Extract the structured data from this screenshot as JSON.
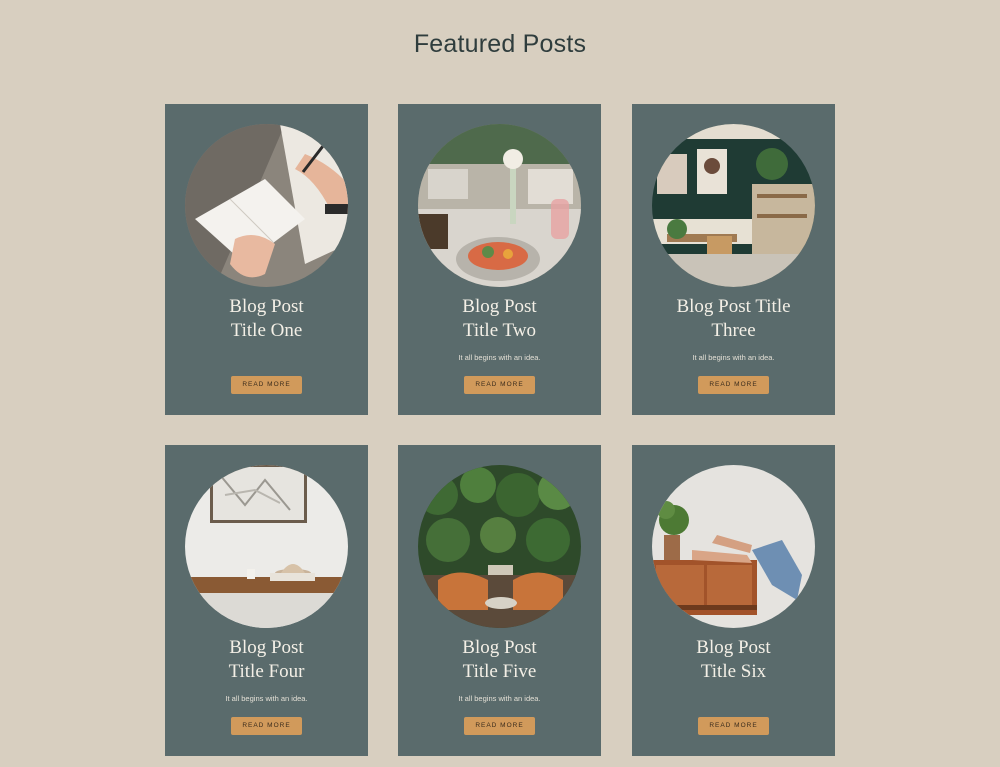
{
  "page": {
    "title": "Featured Posts"
  },
  "posts": [
    {
      "title_line1": "Blog Post",
      "title_line2": "Title One",
      "excerpt": "",
      "button": "READ MORE",
      "image": "writing-notebook-photo"
    },
    {
      "title_line1": "Blog Post",
      "title_line2": "Title Two",
      "excerpt": "It all begins with an idea.",
      "button": "READ MORE",
      "image": "restaurant-table-photo"
    },
    {
      "title_line1": "Blog Post Title",
      "title_line2": "Three",
      "excerpt": "It all begins with an idea.",
      "button": "READ MORE",
      "image": "cafe-interior-photo"
    },
    {
      "title_line1": "Blog Post",
      "title_line2": "Title Four",
      "excerpt": "It all begins with an idea.",
      "button": "READ MORE",
      "image": "console-shelf-photo"
    },
    {
      "title_line1": "Blog Post",
      "title_line2": "Title Five",
      "excerpt": "It all begins with an idea.",
      "button": "READ MORE",
      "image": "green-wall-lounge-photo"
    },
    {
      "title_line1": "Blog Post",
      "title_line2": "Title Six",
      "excerpt": "",
      "button": "READ MORE",
      "image": "feet-on-sideboard-photo"
    }
  ],
  "colors": {
    "background": "#d8cfc0",
    "card": "#5a6b6c",
    "button": "#d19a5b",
    "title_text": "#f3efe6"
  }
}
